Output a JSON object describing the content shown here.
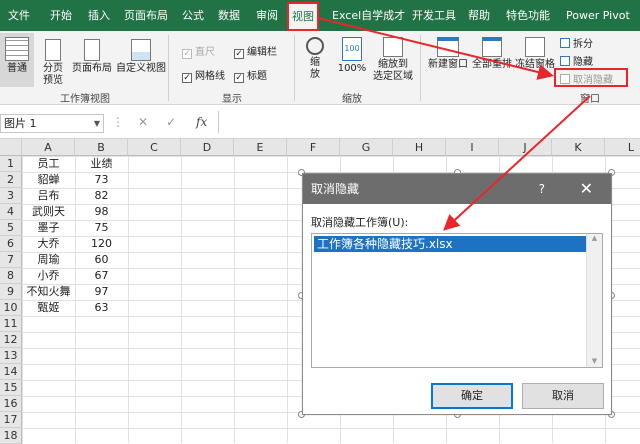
{
  "tabs": [
    "文件",
    "开始",
    "插入",
    "页面布局",
    "公式",
    "数据",
    "审阅",
    "视图",
    "Excel自学成才",
    "开发工具",
    "帮助",
    "特色功能",
    "Power Pivot"
  ],
  "active_tab": "视图",
  "ribbon": {
    "workbook_views": {
      "normal": "普通",
      "page_break": "分页\n预览",
      "page_layout": "页面布局",
      "custom_views": "自定义视图",
      "group_label": "工作簿视图"
    },
    "show": {
      "ruler": "直尺",
      "formula_bar": "编辑栏",
      "gridlines": "网格线",
      "headings": "标题",
      "group_label": "显示"
    },
    "zoom": {
      "zoom": "缩\n放",
      "zoom100": "100%",
      "zoom_selection": "缩放到\n选定区域",
      "group_label": "缩放"
    },
    "window": {
      "new_window": "新建窗口",
      "arrange_all": "全部重排",
      "freeze": "冻结窗格",
      "split": "拆分",
      "hide": "隐藏",
      "unhide": "取消隐藏",
      "group_label": "窗口"
    }
  },
  "formula_bar": {
    "name_box": "图片 1",
    "fx": "fx"
  },
  "sheet": {
    "columns": [
      "A",
      "B",
      "C",
      "D",
      "E",
      "F",
      "G",
      "H",
      "I",
      "J",
      "K",
      "L"
    ],
    "rows": [
      "1",
      "2",
      "3",
      "4",
      "5",
      "6",
      "7",
      "8",
      "9",
      "10",
      "11",
      "12",
      "13",
      "14",
      "15",
      "16",
      "17",
      "18"
    ],
    "data": [
      [
        "员工",
        "业绩"
      ],
      [
        "貂蝉",
        "73"
      ],
      [
        "吕布",
        "82"
      ],
      [
        "武则天",
        "98"
      ],
      [
        "墨子",
        "75"
      ],
      [
        "大乔",
        "120"
      ],
      [
        "周瑜",
        "60"
      ],
      [
        "小乔",
        "67"
      ],
      [
        "不知火舞",
        "97"
      ],
      [
        "甄姬",
        "63"
      ]
    ]
  },
  "dialog": {
    "title": "取消隐藏",
    "help": "?",
    "close": "✕",
    "label": "取消隐藏工作簿(U):",
    "items": [
      "工作簿各种隐藏技巧.xlsx"
    ],
    "ok": "确定",
    "cancel": "取消"
  }
}
